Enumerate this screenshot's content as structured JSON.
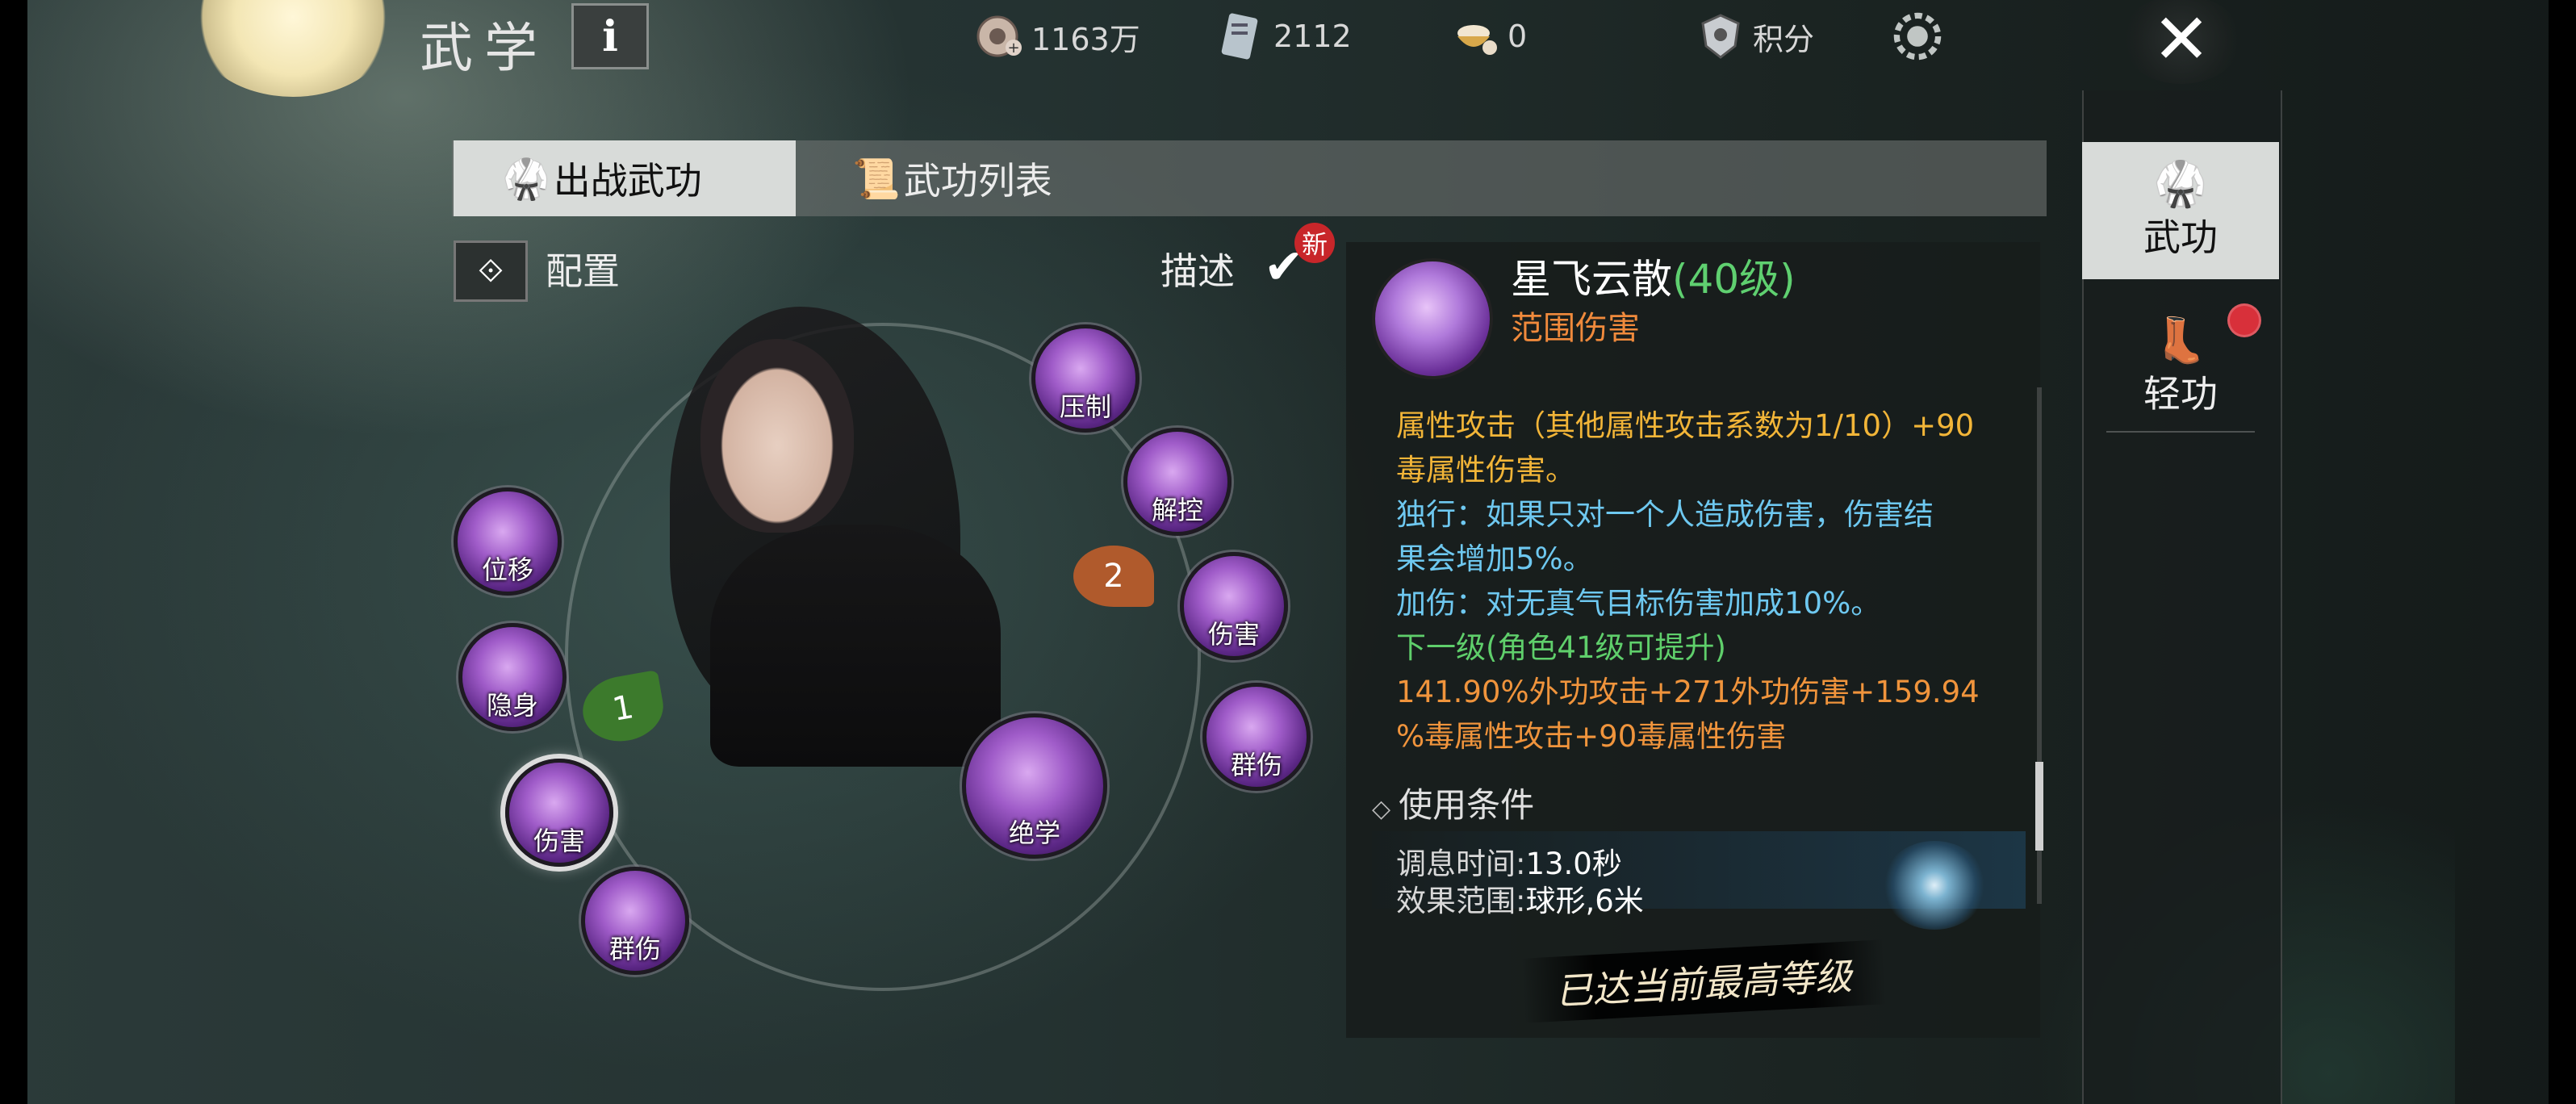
{
  "header": {
    "title": "武学",
    "info_label": "i",
    "currencies": [
      {
        "icon": "coin-icon",
        "value": "1163万"
      },
      {
        "icon": "ticket-icon",
        "value": "2112"
      },
      {
        "icon": "bowl-icon",
        "value": "0"
      }
    ],
    "points_label": "积分",
    "close_label": "✕"
  },
  "tabs": [
    {
      "label": "出战武功",
      "icon": "fighter-icon",
      "active": true
    },
    {
      "label": "武功列表",
      "icon": "scroll-icon",
      "active": false
    }
  ],
  "config_label": "配置",
  "describe_label": "描述",
  "new_badge": "新",
  "skills": [
    {
      "label": "压制"
    },
    {
      "label": "解控"
    },
    {
      "label": "伤害"
    },
    {
      "label": "群伤"
    },
    {
      "label": "绝学"
    },
    {
      "label": "位移"
    },
    {
      "label": "隐身"
    },
    {
      "label": "伤害"
    },
    {
      "label": "群伤"
    }
  ],
  "slot_badges": [
    "1",
    "2"
  ],
  "detail": {
    "name": "星飞云散",
    "level": "(40级)",
    "type": "范围伤害",
    "lines": [
      "属性攻击（其他属性攻击系数为1/10）+90",
      "毒属性伤害。",
      "独行：如果只对一个人造成伤害，伤害结",
      "果会增加5%。",
      "加伤：对无真气目标伤害加成10%。",
      "下一级(角色41级可提升)",
      "141.90%外功攻击+271外功伤害+159.94",
      "%毒属性攻击+90毒属性伤害"
    ],
    "use_condition_label": "使用条件",
    "cooldown_label": "调息时间:",
    "cooldown_value": "13.0秒",
    "range_label": "效果范围:",
    "range_value": "球形,6米",
    "max_level": "已达当前最高等级"
  },
  "side_tabs": [
    {
      "label": "武功",
      "active": true
    },
    {
      "label": "轻功",
      "active": false
    }
  ]
}
